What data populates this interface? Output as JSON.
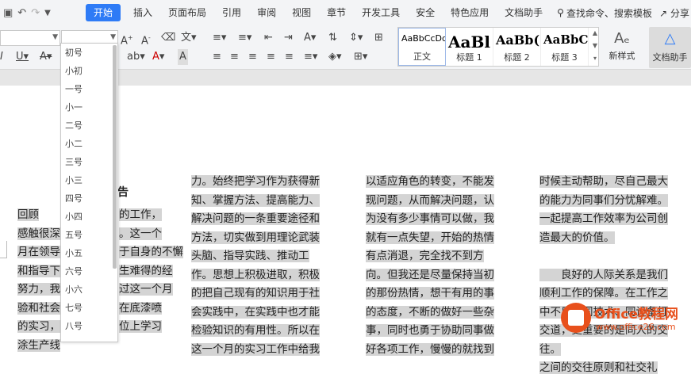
{
  "menubar": {
    "quick_access": [
      "preview-icon",
      "undo-icon",
      "redo-icon",
      "customize-icon"
    ],
    "items": [
      "开始",
      "插入",
      "页面布局",
      "引用",
      "审阅",
      "视图",
      "章节",
      "开发工具",
      "安全",
      "特色应用",
      "文档助手"
    ],
    "active_index": 0,
    "search_label": "查找命令、搜索模板",
    "share_label": "分享"
  },
  "ribbon": {
    "font_name": "",
    "font_size": "",
    "styles": [
      {
        "preview": "AaBbCcDd",
        "name": "正文"
      },
      {
        "preview": "AaBl",
        "name": "标题 1"
      },
      {
        "preview": "AaBb(",
        "name": "标题 2"
      },
      {
        "preview": "AaBbC",
        "name": "标题 3"
      }
    ],
    "new_style_label": "新样式",
    "doc_helper_label": "文档助手",
    "accent": "#2e7bf6"
  },
  "font_size_dropdown": [
    "初号",
    "小初",
    "一号",
    "小一",
    "二号",
    "小二",
    "三号",
    "小三",
    "四号",
    "小四",
    "五号",
    "小五",
    "六号",
    "小六",
    "七号",
    "八号"
  ],
  "document": {
    "title_fragment": "告",
    "col1_visible": [
      "的工作，",
      "。这一个",
      "于自身的不懈",
      "生难得的经",
      "过这一个月",
      "在底漆喷",
      "位上学习"
    ],
    "col1_left": [
      "回顾",
      "感触很深",
      "月在领导",
      "和指导下",
      "努力，我",
      "验和社会",
      "的实习，",
      "涂生产线"
    ],
    "col2": [
      "力。始终把学习作为获得新",
      "知、掌握方法、提高能力、",
      "解决问题的一条重要途径和",
      "方法，切实做到用理论武装",
      "头脑、指导实践、推动工",
      "作。思想上积极进取，积极",
      "的把自己现有的知识用于社",
      "会实践中，在实践中也才能",
      "检验知识的有用性。所以在",
      "这一个月的实习工作中给我"
    ],
    "col3": [
      "以适应角色的转变，不能发",
      "现问题，从而解决问题，认",
      "为没有多少事情可以做，我",
      "就有一点失望，开始的热情",
      "有点消退，完全找不到方",
      "向。但我还是尽量保持当初",
      "的那份热情，想干有用的事",
      "的态度，不断的做好一些杂",
      "事，同时也勇于协助同事做",
      "好各项工作，慢慢的就找到"
    ],
    "col4": [
      "时候主动帮助，尽自己最大",
      "的能力为同事们分忧解难。",
      "一起提高工作效率为公司创",
      "造最大的价值。",
      "",
      "　　良好的人际关系是我们",
      "顺利工作的保障。在工作之",
      "中不只是同技术、同设备打",
      "交道，更重要的是同人的交",
      "往。",
      "之间的交往原则和社交礼"
    ]
  },
  "watermark": {
    "text1": "Office教程网",
    "text2": "www.office26.com"
  }
}
